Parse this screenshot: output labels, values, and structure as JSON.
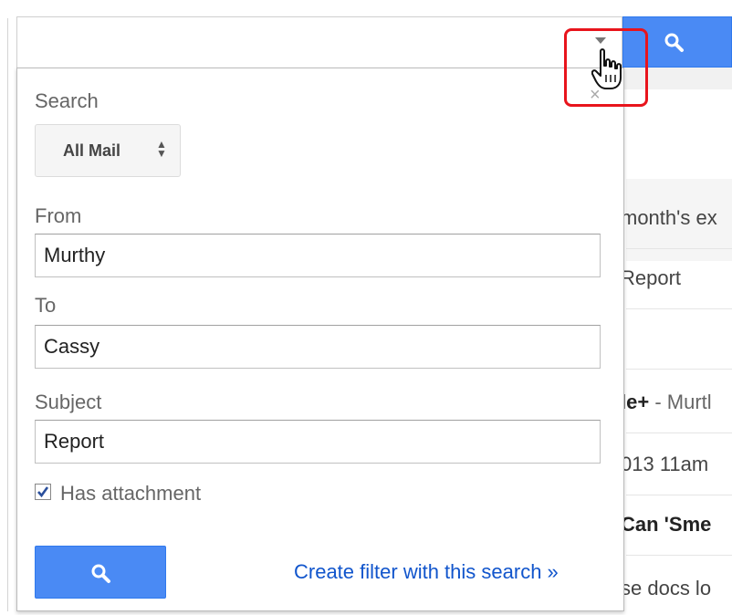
{
  "search": {
    "query_value": "",
    "dropdown_icon": "triangle-down-icon",
    "button_icon": "search-icon"
  },
  "background_rows": [
    {
      "text": "month's ex",
      "bold": false
    },
    {
      "text": "Report",
      "bold": false
    },
    {
      "text": "le+",
      "suffix": " - Murtl",
      "bold": true
    },
    {
      "text": "013 11am",
      "bold": false
    },
    {
      "text": "Can 'Sme",
      "bold": true
    },
    {
      "text": "se docs lo",
      "bold": false
    }
  ],
  "panel": {
    "close_label": "×",
    "search_label": "Search",
    "search_scope": "All Mail",
    "from_label": "From",
    "from_value": "Murthy",
    "to_label": "To",
    "to_value": "Cassy",
    "subject_label": "Subject",
    "subject_value": "Report",
    "has_attachment_label": "Has attachment",
    "has_attachment_checked": true,
    "create_filter_link": "Create filter with this search »"
  },
  "colors": {
    "accent_blue": "#4a8af4",
    "link_blue": "#1155cc",
    "highlight_red": "#e8141c"
  }
}
